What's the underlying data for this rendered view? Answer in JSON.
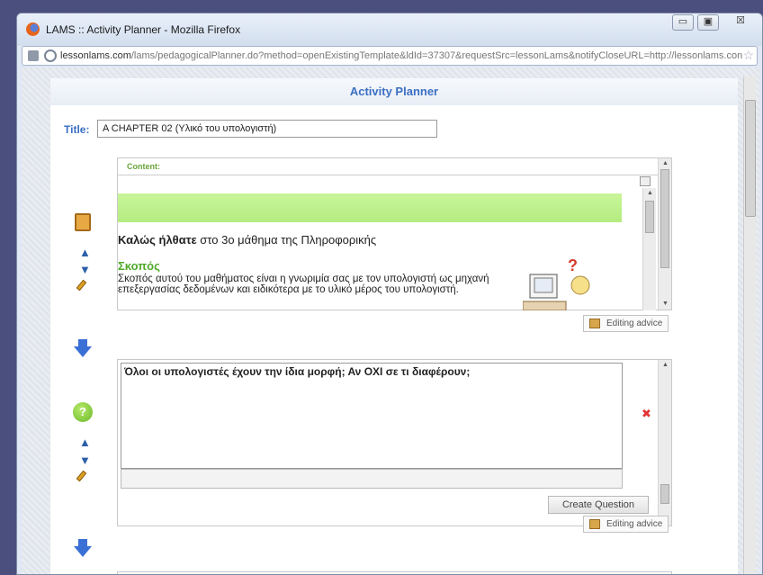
{
  "window": {
    "title": "LAMS :: Activity Planner - Mozilla Firefox",
    "url_domain": "lessonlams.com",
    "url_path": "/lams/pedagogicalPlanner.do?method=openExistingTemplate&ldId=37307&requestSrc=lessonLams&notifyCloseURL=http://lessonlams.con"
  },
  "page": {
    "heading": "Activity Planner",
    "title_label": "Title:",
    "title_value": "A CHAPTER 02 (Υλικό του υπολογιστή)"
  },
  "activity1": {
    "content_label": "Content:",
    "welcome_bold": "Καλώς ήλθατε",
    "welcome_rest": " στο 3ο μάθημα της Πληροφορικής",
    "section_heading": "Σκοπός",
    "body_text": "Σκοπός αυτού του μαθήματος είναι η γνωριμία σας με τον υπολογιστή ως μηχανή επεξεργασίας δεδομένων και ειδικότερα με το υλικό μέρος του υπολογιστή.",
    "editing_advice": "Editing advice"
  },
  "activity2": {
    "question_text": "Όλοι οι υπολογιστές έχουν την ίδια μορφή;  Αν ΟΧΙ σε τι διαφέρουν;",
    "create_button": "Create Question",
    "editing_advice": "Editing advice",
    "delete_glyph": "✖"
  },
  "icons": {
    "up": "▲",
    "down": "▼",
    "help": "?",
    "close": "☒",
    "minimize": "▭",
    "maximize": "▣",
    "star": "☆"
  }
}
